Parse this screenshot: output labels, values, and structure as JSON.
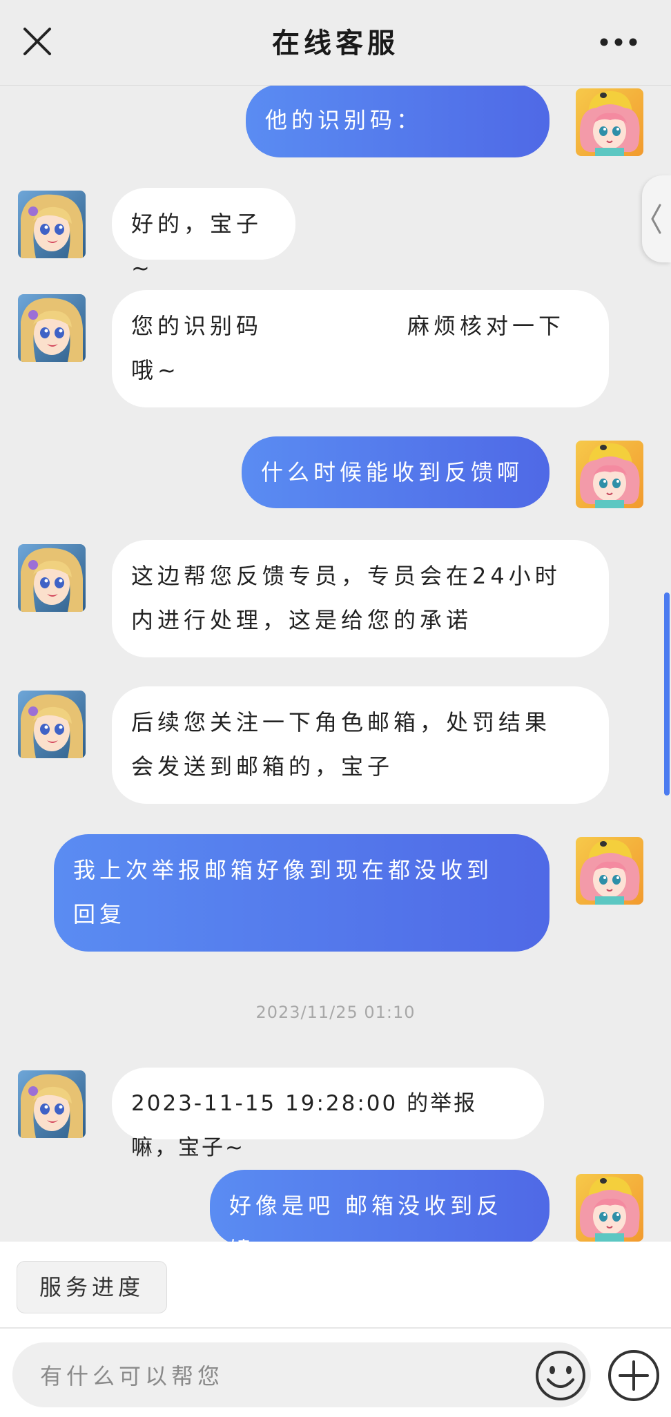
{
  "header": {
    "title": "在线客服",
    "close_icon": "close-icon",
    "more_icon": "more-horizontal-icon"
  },
  "colors": {
    "user_bubble_start": "#5a8cf2",
    "user_bubble_end": "#4f69e6",
    "agent_bubble": "#ffffff",
    "background": "#ededed"
  },
  "messages": [
    {
      "sender": "user",
      "text": "他的识别码："
    },
    {
      "sender": "agent",
      "text": "好的，宝子~"
    },
    {
      "sender": "agent",
      "text_part1": "您的识别码",
      "text_part2": "麻烦核对一下",
      "text_part3": "哦~"
    },
    {
      "sender": "user",
      "text": "什么时候能收到反馈啊"
    },
    {
      "sender": "agent",
      "line1": "这边帮您反馈专员，专员会在24小时",
      "line2": "内进行处理，这是给您的承诺"
    },
    {
      "sender": "agent",
      "line1": "后续您关注一下角色邮箱，处罚结果",
      "line2": "会发送到邮箱的，宝子"
    },
    {
      "sender": "user",
      "line1": "我上次举报邮箱好像到现在都没收到",
      "line2": "回复"
    },
    {
      "sender": "agent",
      "text": "2023-11-15 19:28:00 的举报嘛，宝子~"
    },
    {
      "sender": "user",
      "text": "好像是吧 邮箱没收到反馈"
    }
  ],
  "timestamp": "2023/11/25 01:10",
  "quick_actions": {
    "service_progress": "服务进度"
  },
  "input": {
    "placeholder": "有什么可以帮您"
  }
}
